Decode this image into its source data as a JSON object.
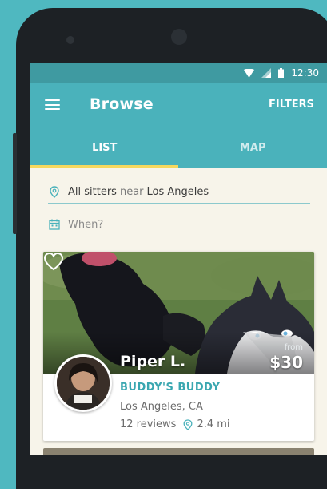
{
  "colors": {
    "background": "#4fb8c0",
    "appbar": "#4ab2bb",
    "statusbar": "#3f9aa1",
    "tab_indicator": "#f5d85e",
    "accent_text": "#3aa7b0",
    "screen_bg": "#f7f4ea"
  },
  "statusbar": {
    "time": "12:30",
    "icons": [
      "wifi-icon",
      "signal-icon",
      "battery-icon"
    ]
  },
  "appbar": {
    "menu_icon": "hamburger-menu-icon",
    "title": "Browse",
    "filters_label": "FILTERS"
  },
  "tabs": [
    {
      "label": "LIST",
      "active": true
    },
    {
      "label": "MAP",
      "active": false
    }
  ],
  "search": {
    "location_icon": "location-pin-icon",
    "prefix": "All sitters",
    "connector": "near",
    "location": "Los Angeles",
    "date_icon": "calendar-icon",
    "date_placeholder": "When?"
  },
  "listing": {
    "name": "Piper L.",
    "price_prefix": "from",
    "price": "$30",
    "business": "BUDDY'S BUDDY",
    "location": "Los Angeles, CA",
    "reviews": "12 reviews",
    "distance": "2.4 mi",
    "favorite_icon": "heart-outline-icon"
  }
}
